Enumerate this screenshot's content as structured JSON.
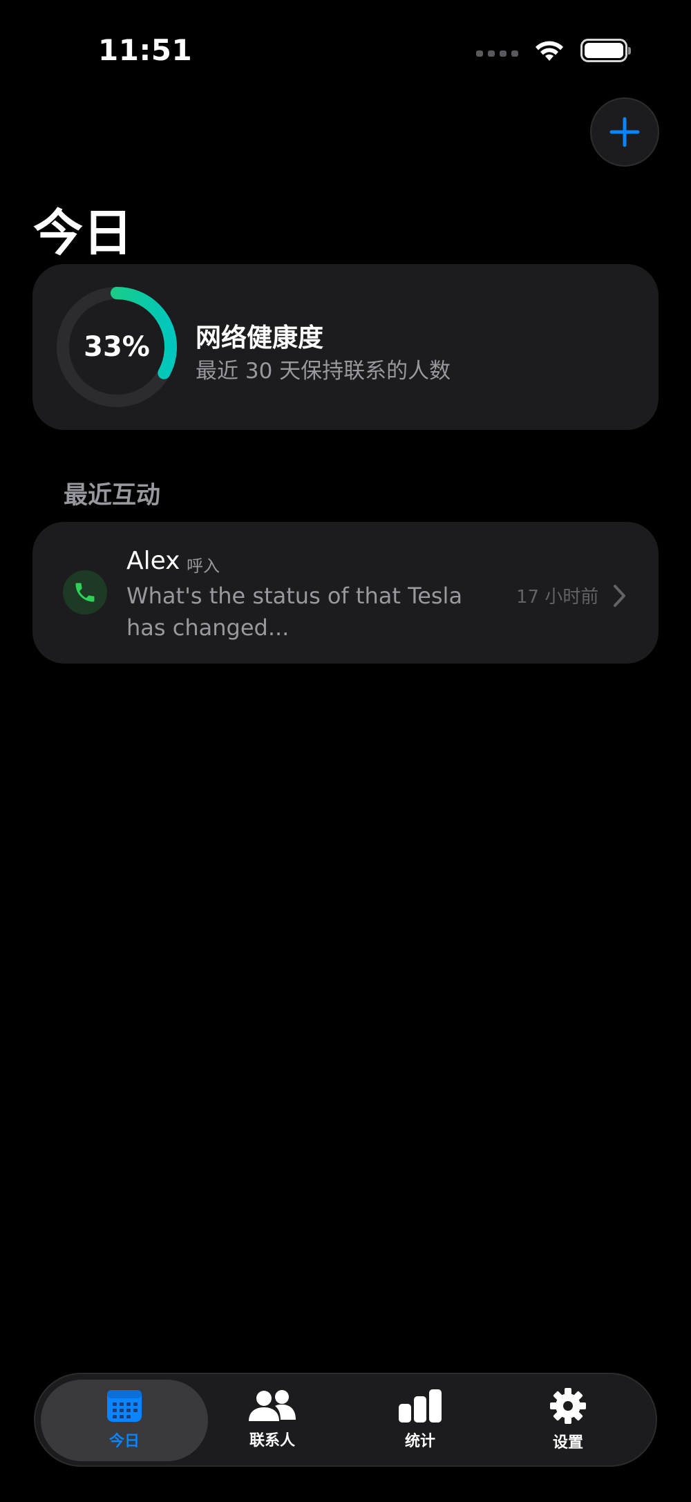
{
  "status_bar": {
    "time": "11:51"
  },
  "header": {
    "title": "今日"
  },
  "health_card": {
    "percent": 33,
    "percent_label": "33%",
    "title": "网络健康度",
    "subtitle": "最近 30 天保持联系的人数"
  },
  "recent": {
    "section_title": "最近互动",
    "items": [
      {
        "name": "Alex",
        "type": "呼入",
        "message": "What's the status of that Tesla has changed...",
        "time_ago": "17 小时前"
      }
    ]
  },
  "tab_bar": {
    "tabs": [
      {
        "label": "今日",
        "icon": "calendar-icon",
        "active": true
      },
      {
        "label": "联系人",
        "icon": "people-icon",
        "active": false
      },
      {
        "label": "统计",
        "icon": "bar-chart-icon",
        "active": false
      },
      {
        "label": "设置",
        "icon": "gear-icon",
        "active": false
      }
    ]
  },
  "colors": {
    "accent": "#0a84ff",
    "ring_start": "#30d158",
    "ring_end": "#00c7be",
    "call_green": "#30d158"
  }
}
